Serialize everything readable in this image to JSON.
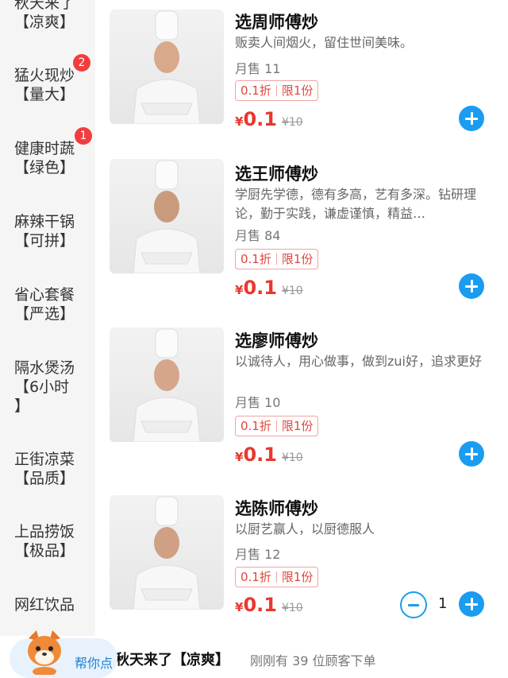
{
  "sidebar": {
    "categories": [
      {
        "line1": "秋天来了",
        "line2": "【凉爽】",
        "badge": ""
      },
      {
        "line1": "猛火现炒",
        "line2": "【量大】",
        "badge": "2"
      },
      {
        "line1": "健康时蔬",
        "line2": "【绿色】",
        "badge": "1"
      },
      {
        "line1": "麻辣干锅",
        "line2": "【可拼】",
        "badge": ""
      },
      {
        "line1": "省心套餐",
        "line2": "【严选】",
        "badge": ""
      },
      {
        "line1": "隔水煲汤",
        "line2": "【6小时",
        "line3": "】",
        "badge": ""
      },
      {
        "line1": "正街凉菜",
        "line2": "【品质】",
        "badge": ""
      },
      {
        "line1": "上品捞饭",
        "line2": "【极品】",
        "badge": ""
      },
      {
        "line1": "网红饮品",
        "line2": "",
        "badge": ""
      }
    ]
  },
  "items": [
    {
      "title": "选周师傅炒",
      "desc": "贩卖人间烟火，留住世间美味。",
      "sales": "月售 11",
      "discount": "0.1折",
      "limit": "限1份",
      "currency": "¥",
      "price": "0.1",
      "orig": "¥10",
      "icon": "plus-icon"
    },
    {
      "title": "选王师傅炒",
      "desc": "学厨先学德，德有多高，艺有多深。钻研理论，勤于实践，谦虚谨慎，精益…",
      "sales": "月售 84",
      "discount": "0.1折",
      "limit": "限1份",
      "currency": "¥",
      "price": "0.1",
      "orig": "¥10",
      "icon": "plus-icon"
    },
    {
      "title": "选廖师傅炒",
      "desc": "以诚待人，用心做事，做到zui好，追求更好",
      "sales": "月售 10",
      "discount": "0.1折",
      "limit": "限1份",
      "currency": "¥",
      "price": "0.1",
      "orig": "¥10",
      "icon": "plus-icon"
    },
    {
      "title": "选陈师傅炒",
      "desc": "以厨艺赢人，以厨德服人",
      "sales": "月售 12",
      "discount": "0.1折",
      "limit": "限1份",
      "currency": "¥",
      "price": "0.1",
      "orig": "¥10",
      "quantity": "1",
      "icon": "plus-icon"
    }
  ],
  "footer": {
    "category": "秋天来了【凉爽】",
    "notice": "刚刚有 39 位顾客下单",
    "helper_label": "帮你点",
    "helper_icon": "mascot-icon"
  },
  "colors": {
    "accent": "#1a9cf0",
    "price": "#e8382f",
    "badge": "#f23d3d"
  }
}
